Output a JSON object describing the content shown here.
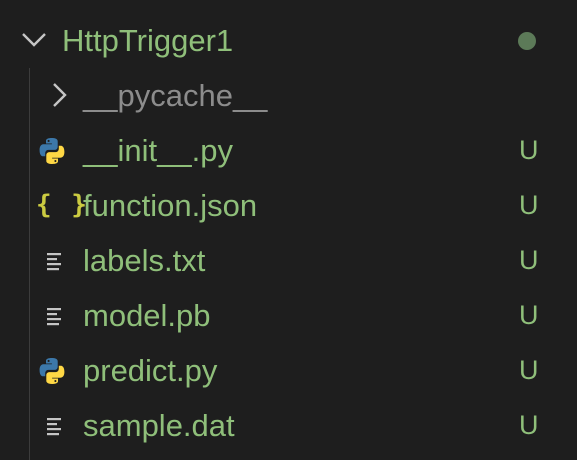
{
  "folder": {
    "name": "HttpTrigger1",
    "icon": "chevron-down-icon",
    "modified_dot_color": "#5c7a58"
  },
  "items": [
    {
      "name": "__pycache__",
      "type": "folder",
      "icon": "chevron-right-icon",
      "status": ""
    },
    {
      "name": "__init__.py",
      "type": "file",
      "icon": "python-icon",
      "status": "U"
    },
    {
      "name": "function.json",
      "type": "file",
      "icon": "json-icon",
      "icon_glyph": "{ }",
      "status": "U"
    },
    {
      "name": "labels.txt",
      "type": "file",
      "icon": "text-file-icon",
      "status": "U"
    },
    {
      "name": "model.pb",
      "type": "file",
      "icon": "text-file-icon",
      "status": "U"
    },
    {
      "name": "predict.py",
      "type": "file",
      "icon": "python-icon",
      "status": "U"
    },
    {
      "name": "sample.dat",
      "type": "file",
      "icon": "text-file-icon",
      "status": "U"
    }
  ],
  "colors": {
    "background": "#1e1e1e",
    "untracked": "#8fbf7a",
    "ignored": "#8c8c8c",
    "json_icon": "#cbcb41",
    "python_blue": "#3c78aa",
    "python_yellow": "#ffd845"
  }
}
